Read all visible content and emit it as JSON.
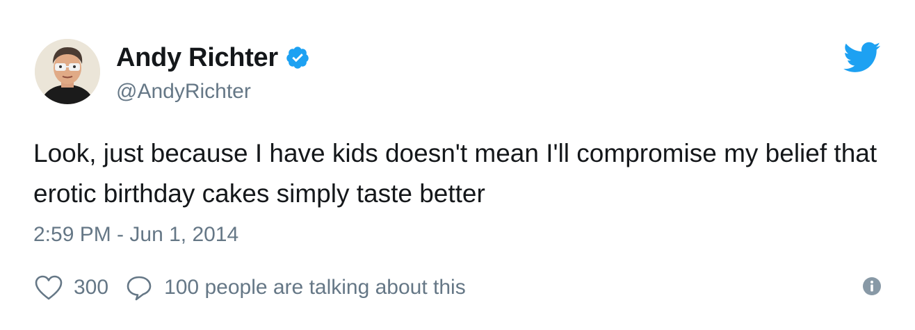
{
  "author": {
    "display_name": "Andy Richter",
    "handle": "@AndyRichter",
    "verified": true,
    "avatar_icon": "avatar-icon"
  },
  "tweet": {
    "text": "Look, just because I have kids doesn't mean I'll compromise my belief that erotic birthday cakes simply taste better",
    "timestamp": "2:59 PM - Jun 1, 2014"
  },
  "actions": {
    "likes": "300",
    "talking": "100 people are talking about this"
  },
  "icons": {
    "verified": "verified-badge-icon",
    "brand": "twitter-bird-icon",
    "like": "heart-icon",
    "reply": "speech-bubble-icon",
    "info": "info-icon"
  },
  "colors": {
    "brand_blue": "#1da1f2",
    "text_primary": "#14171a",
    "text_secondary": "#657786"
  }
}
